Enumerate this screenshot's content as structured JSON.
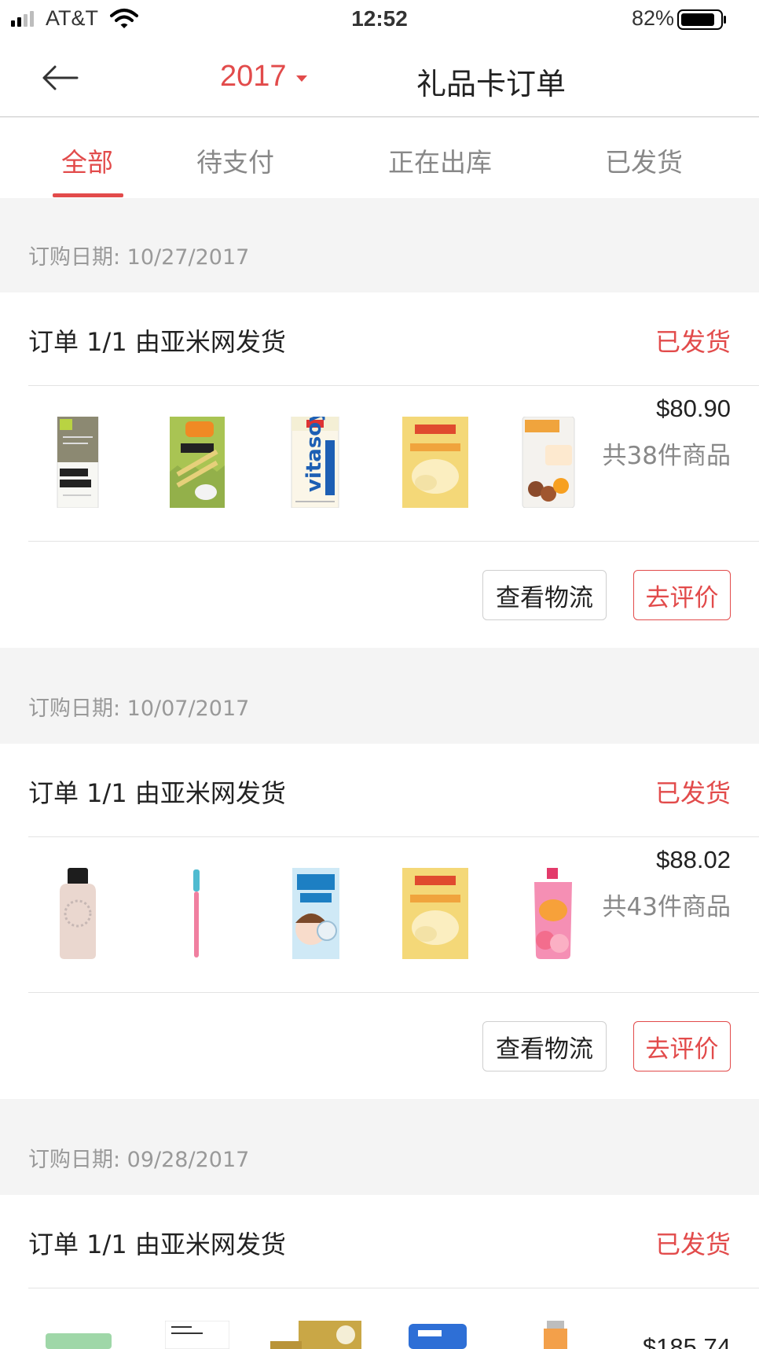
{
  "status_bar": {
    "carrier": "AT&T",
    "time": "12:52",
    "battery": "82%"
  },
  "header": {
    "year": "2017",
    "title": "礼品卡订单"
  },
  "tabs": [
    {
      "label": "全部",
      "active": true
    },
    {
      "label": "待支付",
      "active": false
    },
    {
      "label": "正在出库",
      "active": false
    },
    {
      "label": "已发货",
      "active": false
    }
  ],
  "orders": [
    {
      "date": "订购日期: 10/27/2017",
      "label": "订单 1/1 由亚米网发货",
      "status": "已发货",
      "price": "$80.90",
      "count": "共38件商品",
      "products": [
        "for-back-soap",
        "321-wafer-rolls",
        "vitasoy-milk",
        "honey-butter-chip",
        "chestnuts-snack"
      ],
      "buttons": {
        "logistics": "查看物流",
        "review": "去评价"
      }
    },
    {
      "date": "订购日期: 10/07/2017",
      "label": "订单 1/1 由亚米网发货",
      "status": "已发货",
      "price": "$88.02",
      "count": "共43件商品",
      "products": [
        "pink-lotion-bottle",
        "toothbrush",
        "nexcare-mask",
        "honey-butter-chip",
        "peach-jelly-pouch"
      ],
      "buttons": {
        "logistics": "查看物流",
        "review": "去评价"
      }
    },
    {
      "date": "订购日期: 09/28/2017",
      "label": "订单 1/1 由亚米网发货",
      "status": "已发货",
      "price": "$185.74",
      "products": [
        "green-jar",
        "vital-hydra-solution",
        "gold-cream-jar",
        "blue-box",
        "orange-serum"
      ]
    }
  ],
  "colors": {
    "accent": "#e24b4b",
    "background": "#f4f4f4"
  }
}
